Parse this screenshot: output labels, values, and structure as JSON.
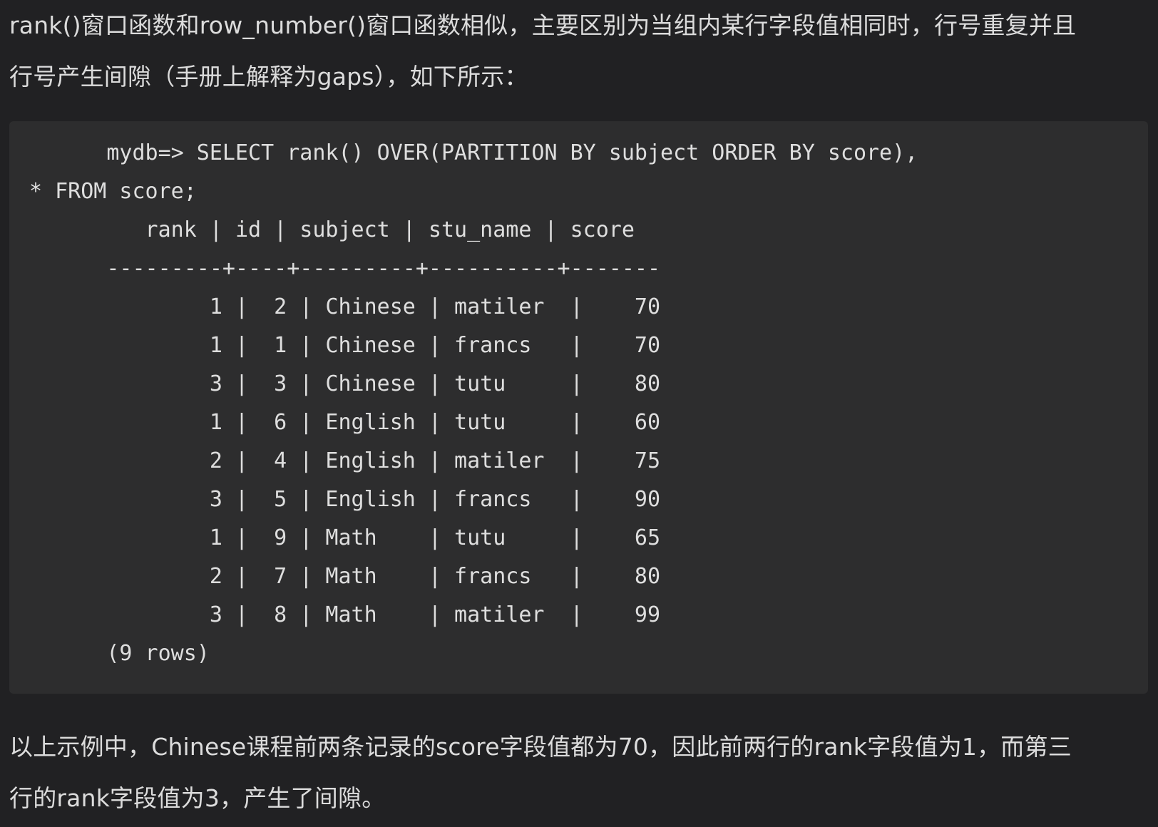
{
  "intro": {
    "line1": "rank()窗口函数和row_number()窗口函数相似，主要区别为当组内某行字段值相同时，行号重复并且",
    "line2": "行号产生间隙（手册上解释为gaps），如下所示："
  },
  "code": {
    "lines": [
      "      mydb=> SELECT rank() OVER(PARTITION BY subject ORDER BY score),",
      "* FROM score;",
      "         rank | id | subject | stu_name | score",
      "      ---------+----+---------+----------+-------",
      "              1 |  2 | Chinese | matiler  |    70",
      "              1 |  1 | Chinese | francs   |    70",
      "              3 |  3 | Chinese | tutu     |    80",
      "              1 |  6 | English | tutu     |    60",
      "              2 |  4 | English | matiler  |    75",
      "              3 |  5 | English | francs   |    90",
      "              1 |  9 | Math    | tutu     |    65",
      "              2 |  7 | Math    | francs   |    80",
      "              3 |  8 | Math    | matiler  |    99",
      "      (9 rows)"
    ]
  },
  "outro": {
    "line1": "以上示例中，Chinese课程前两条记录的score字段值都为70，因此前两行的rank字段值为1，而第三",
    "line2": "行的rank字段值为3，产生了间隙。"
  }
}
